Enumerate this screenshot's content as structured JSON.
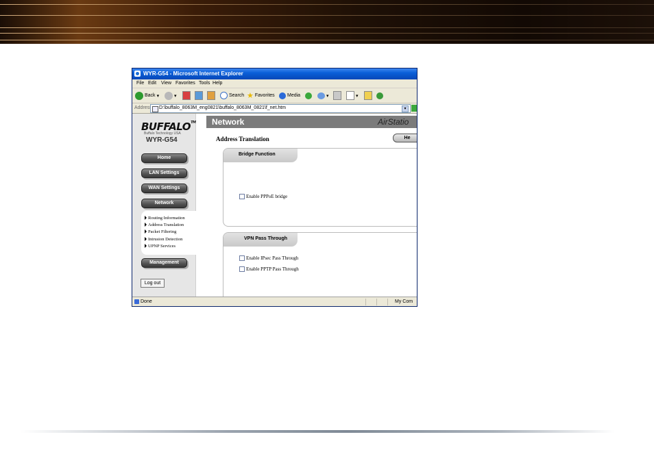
{
  "browser": {
    "title": "WYR-G54 - Microsoft Internet Explorer",
    "menu": [
      "File",
      "Edit",
      "View",
      "Favorites",
      "Tools",
      "Help"
    ],
    "toolbar": {
      "back": "Back",
      "search": "Search",
      "favorites": "Favorites",
      "media": "Media"
    },
    "address": {
      "label": "Address",
      "value": "D:\\buffalo_8063M_eng0821\\buffalo_8063M_0821\\f_net.htm"
    },
    "status": {
      "text": "Done",
      "zone": "My Com"
    }
  },
  "sidebar": {
    "brand": "BUFFALO",
    "brand_tm": "TM",
    "brand_sub": "Buffalo Technology USA",
    "model": "WYR-G54",
    "nav": [
      "Home",
      "LAN Settings",
      "WAN Settings",
      "Network",
      "Management"
    ],
    "submenu": [
      "Routing Information",
      "Address Translation",
      "Packet Filtering",
      "Intrusion Detection",
      "UPNP Services"
    ],
    "logout": "Log out"
  },
  "main": {
    "header": "Network",
    "brand": "AirStatio",
    "page_title": "Address Translation",
    "help": "He",
    "bridge": {
      "title": "Bridge Function",
      "checkbox": "Enable PPPoE bridge"
    },
    "vpn": {
      "title": "VPN Pass Through",
      "ipsec": "Enable IPsec Pass Through",
      "pptp": "Enable PPTP Pass Through"
    }
  },
  "colors": {
    "titlebar": "#0a5fd8",
    "header": "#7b7b7b",
    "button": "#555555"
  }
}
